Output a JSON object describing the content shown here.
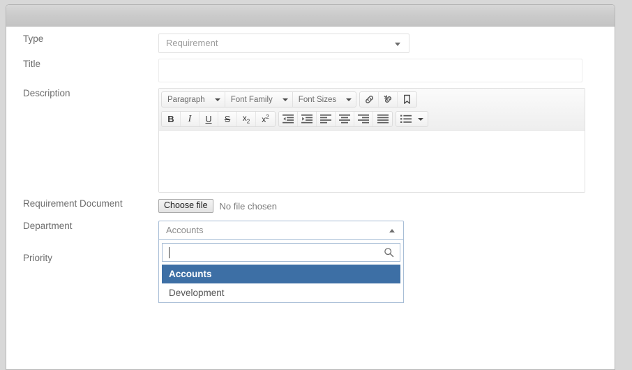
{
  "window": {
    "titlebar_text": ""
  },
  "form": {
    "rows": [
      {
        "label": "Type"
      },
      {
        "label": "Title"
      },
      {
        "label": "Description"
      },
      {
        "label": "Requirement Document"
      },
      {
        "label": "Department"
      },
      {
        "label": "Priority"
      }
    ],
    "type": {
      "label": "Type",
      "value": "Requirement",
      "caret_icon": "chevron-down-icon"
    },
    "title": {
      "label": "Title",
      "value": "",
      "placeholder": ""
    },
    "description": {
      "label": "Description",
      "content": ""
    },
    "requirement_document": {
      "label": "Requirement Document",
      "button_label": "Choose file",
      "status_text": "No file chosen"
    },
    "department": {
      "label": "Department",
      "value": "Accounts",
      "caret_icon": "chevron-up-icon",
      "expanded": true,
      "search": {
        "value": "",
        "placeholder": "",
        "icon": "search-icon"
      },
      "options": [
        {
          "label": "Accounts",
          "selected": true
        },
        {
          "label": "Development",
          "selected": false
        }
      ]
    },
    "priority": {
      "label": "Priority"
    }
  },
  "editor": {
    "toolbar_row1": [
      {
        "name": "paragraph-format-select",
        "label": "Paragraph",
        "icon": "chevron-down-icon"
      },
      {
        "name": "font-family-select",
        "label": "Font Family",
        "icon": "chevron-down-icon"
      },
      {
        "name": "font-sizes-select",
        "label": "Font Sizes",
        "icon": "chevron-down-icon"
      }
    ],
    "toolbar_row1_icons": [
      {
        "name": "insert-link-button",
        "icon": "link-icon"
      },
      {
        "name": "remove-link-button",
        "icon": "unlink-icon"
      },
      {
        "name": "insert-anchor-button",
        "icon": "anchor-bookmark-icon"
      }
    ],
    "toolbar_row2_text": [
      {
        "name": "bold-button",
        "icon": "bold-icon",
        "glyph": "B"
      },
      {
        "name": "italic-button",
        "icon": "italic-icon",
        "glyph": "I"
      },
      {
        "name": "underline-button",
        "icon": "underline-icon",
        "glyph": "U"
      },
      {
        "name": "strikethrough-button",
        "icon": "strikethrough-icon",
        "glyph": "S"
      },
      {
        "name": "subscript-button",
        "icon": "subscript-icon",
        "glyph": "x"
      },
      {
        "name": "superscript-button",
        "icon": "superscript-icon",
        "glyph": "x"
      }
    ],
    "toolbar_row2_align": [
      {
        "name": "outdent-button",
        "icon": "outdent-icon"
      },
      {
        "name": "indent-button",
        "icon": "indent-icon"
      },
      {
        "name": "align-left-button",
        "icon": "align-left-icon"
      },
      {
        "name": "align-center-button",
        "icon": "align-center-icon"
      },
      {
        "name": "align-right-button",
        "icon": "align-right-icon"
      },
      {
        "name": "justify-button",
        "icon": "align-justify-icon"
      }
    ],
    "toolbar_row2_list": [
      {
        "name": "bullet-list-button",
        "icon": "bullet-list-icon"
      }
    ]
  },
  "colors": {
    "page_background": "#d8d8d8",
    "panel_background": "#ffffff",
    "titlebar_gradient_top": "#d7d7d7",
    "titlebar_gradient_bottom": "#c4c4c4",
    "label_text": "#6d6d6d",
    "input_border": "#e2e2e2",
    "focus_border": "#a7bdd6",
    "option_highlight": "#3d6fa5",
    "option_highlight_text": "#ffffff"
  }
}
